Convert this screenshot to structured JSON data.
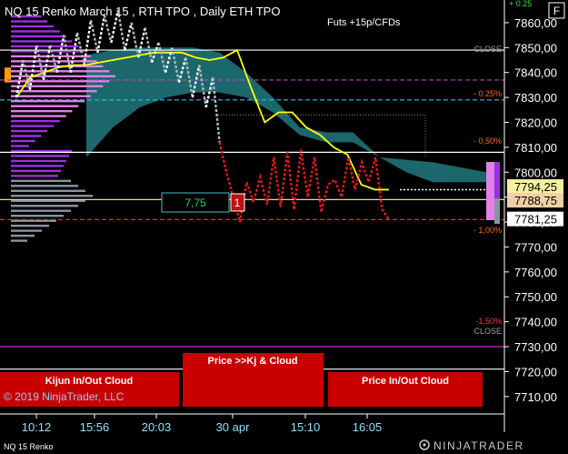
{
  "header": {
    "title": "NQ 15 Renko March 15 , RTH TPO , Daily ETH TPO",
    "note": "Futs +15p/CFDs",
    "f_button": "F"
  },
  "footer": {
    "instrument": "NQ 15 Renko",
    "copyright": "© 2019 NinjaTrader, LLC",
    "brand": "NINJATRADER"
  },
  "top_marker": "+ 0.25",
  "right_labels": {
    "close_top": "CLOSE",
    "close_bottom": "CLOSE",
    "p025": "- 0.25%",
    "p050": "- 0,50%",
    "p100": "- 1,00%",
    "p150": "-1,50%"
  },
  "boxes": {
    "counter_value": "7,75",
    "counter_badge": "1",
    "cloud_left": "Kijun In/Out Cloud",
    "cloud_mid": "Price >>Kj & Cloud",
    "cloud_right": "Price In/Out Cloud"
  },
  "price_tags": [
    {
      "value": "7794,25",
      "bg": "#f5f0a0",
      "color": "#000000"
    },
    {
      "value": "7788,75",
      "bg": "#f0d0a8",
      "color": "#000000"
    },
    {
      "value": "7781,25",
      "bg": "#ffffff",
      "color": "#000000"
    }
  ],
  "colors": {
    "background": "#000000",
    "cloud": "#1e7277",
    "renko_up_early": "#ffffff",
    "renko_down_early": "#b0b8c0",
    "renko_late": "#e01818",
    "kijun": "#ffff00",
    "tpo_purple": "#9c30e0",
    "tpo_pink": "#e080e8",
    "tpo_grey": "#8a94a0",
    "axis_text": "#ffffff",
    "time_text": "#8fe0ff",
    "box_red": "#c80000"
  },
  "chart_data": {
    "type": "line",
    "title": "NQ 15 Renko March 15 , RTH TPO , Daily ETH TPO",
    "ylabel": "",
    "xlabel": "",
    "ylim": [
      7703,
      7868
    ],
    "y_ticks": [
      7860,
      7850,
      7840,
      7830,
      7820,
      7810,
      7800,
      7790,
      7780,
      7770,
      7760,
      7750,
      7740,
      7730,
      7720,
      7710
    ],
    "y_tick_labels": [
      "7860,00",
      "7850,00",
      "7840,00",
      "7830,00",
      "7820,00",
      "7810,00",
      "7800,00",
      "7790,00",
      "7780,00",
      "7770,00",
      "7760,00",
      "7750,00",
      "7740,00",
      "7730,00",
      "7720,00",
      "7710,00"
    ],
    "x_tick_labels": [
      "10:12",
      "15:56",
      "20:03",
      "30 apr",
      "15:10",
      "16:05"
    ],
    "grid": false,
    "series": [
      {
        "kind": "renko",
        "values": [
          7830,
          7845,
          7833,
          7851,
          7837,
          7851,
          7840,
          7855,
          7840,
          7856,
          7843,
          7861,
          7848,
          7863,
          7852,
          7865,
          7849,
          7860,
          7846,
          7858,
          7844,
          7852,
          7840,
          7850,
          7836,
          7846,
          7830,
          7843,
          7826,
          7838,
          7812,
          7800,
          7790,
          7780,
          7796,
          7788,
          7798,
          7787,
          7806,
          7786,
          7808,
          7785,
          7809,
          7790,
          7806,
          7784,
          7795,
          7797,
          7790,
          7806,
          7793,
          7804,
          7796,
          7806,
          7785,
          7781
        ]
      },
      {
        "kind": "kijun",
        "values": [
          7830,
          7838,
          7840,
          7842,
          7843,
          7843,
          7844,
          7845,
          7846,
          7847,
          7848,
          7848,
          7848,
          7846,
          7845,
          7846,
          7849,
          7834,
          7820,
          7824,
          7824,
          7818,
          7815,
          7810,
          7807,
          7795,
          7793,
          7793
        ]
      }
    ],
    "horizontal_levels": [
      {
        "label": "CLOSE",
        "value": 7849,
        "color": "#ffffff",
        "style": "solid"
      },
      {
        "label": "- 0.25%",
        "value": 7837,
        "color": "#c040c0",
        "style": "dashed"
      },
      {
        "label": "",
        "value": 7829,
        "color": "#30c0f0",
        "style": "dashed"
      },
      {
        "label": "",
        "value": 7808,
        "color": "#ffffff",
        "style": "solid"
      },
      {
        "label": "",
        "value": 7789,
        "color": "#f0d0a8",
        "style": "solid"
      },
      {
        "label": "- 1,00%",
        "value": 7781,
        "color": "#ff3030",
        "style": "dashed"
      },
      {
        "label": "CLOSE",
        "value": 7730,
        "color": "#e020e0",
        "style": "solid"
      },
      {
        "label": "",
        "value": 7721,
        "color": "#ffffff",
        "style": "solid"
      }
    ],
    "cloud": {
      "upper": [
        7847,
        7849,
        7850,
        7850,
        7850,
        7848,
        7840,
        7830,
        7818,
        7816,
        7816,
        7806,
        7805,
        7804,
        7802,
        7800
      ],
      "lower": [
        7806,
        7818,
        7826,
        7830,
        7832,
        7832,
        7830,
        7824,
        7815,
        7812,
        7812,
        7806,
        7800,
        7796,
        7796,
        7796
      ]
    }
  }
}
